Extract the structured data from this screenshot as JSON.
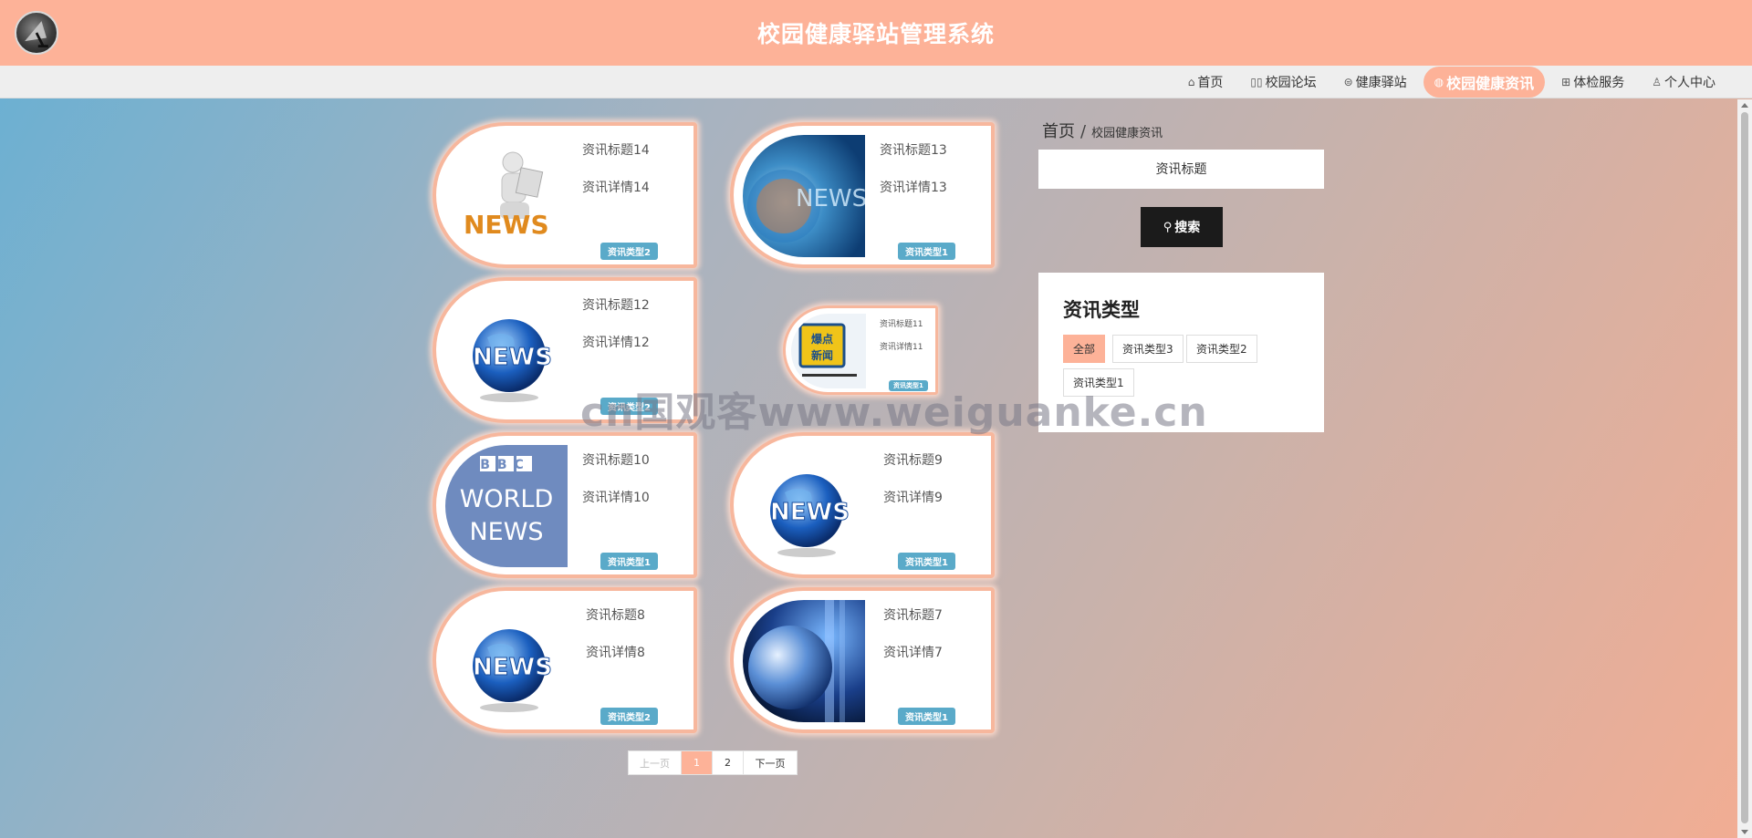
{
  "header": {
    "title": "校园健康驿站管理系统",
    "logo_icon": "satellite-dish-logo"
  },
  "nav": {
    "items": [
      {
        "label": "首页",
        "icon": "home-icon",
        "glyph": "⌂",
        "active": false
      },
      {
        "label": "校园论坛",
        "icon": "forum-icon",
        "glyph": "▯▯",
        "active": false
      },
      {
        "label": "健康驿站",
        "icon": "station-icon",
        "glyph": "⊜",
        "active": false
      },
      {
        "label": "校园健康资讯",
        "icon": "globe-icon",
        "glyph": "◍",
        "active": true
      },
      {
        "label": "体检服务",
        "icon": "gift-icon",
        "glyph": "⊞",
        "active": false
      },
      {
        "label": "个人中心",
        "icon": "user-icon",
        "glyph": "♙",
        "active": false
      }
    ]
  },
  "cards": [
    {
      "title": "资讯标题14",
      "detail": "资讯详情14",
      "type": "资讯类型2",
      "image": "news-3d-man"
    },
    {
      "title": "资讯标题13",
      "detail": "资讯详情13",
      "type": "资讯类型1",
      "image": "news-blue-studio"
    },
    {
      "title": "资讯标题12",
      "detail": "资讯详情12",
      "type": "资讯类型2",
      "image": "news-globe"
    },
    {
      "title": "资讯标题11",
      "detail": "资讯详情11",
      "type": "资讯类型1",
      "image": "hot-news-badge"
    },
    {
      "title": "资讯标题10",
      "detail": "资讯详情10",
      "type": "资讯类型1",
      "image": "bbc-world-news"
    },
    {
      "title": "资讯标题9",
      "detail": "资讯详情9",
      "type": "资讯类型1",
      "image": "news-globe"
    },
    {
      "title": "资讯标题8",
      "detail": "资讯详情8",
      "type": "资讯类型2",
      "image": "news-globe"
    },
    {
      "title": "资讯标题7",
      "detail": "资讯详情7",
      "type": "资讯类型1",
      "image": "news-earth-studio"
    }
  ],
  "images": {
    "bbc_line1": "BBC",
    "bbc_line2": "WORLD",
    "bbc_line3": "NEWS",
    "globe_text": "NEWS",
    "man_text": "NEWS",
    "hot_line1": "爆点",
    "hot_line2": "新闻",
    "studio_text": "NEWS"
  },
  "pagination": {
    "prev": "上一页",
    "pages": [
      "1",
      "2"
    ],
    "current": "1",
    "next": "下一页"
  },
  "breadcrumb": {
    "home": "首页",
    "separator": "/",
    "current": "校园健康资讯"
  },
  "search": {
    "placeholder": "资讯标题",
    "button": "搜索",
    "icon": "search-icon"
  },
  "types": {
    "title": "资讯类型",
    "tags": [
      {
        "label": "全部",
        "active": true
      },
      {
        "label": "资讯类型3",
        "active": false
      },
      {
        "label": "资讯类型2",
        "active": false
      },
      {
        "label": "资讯类型1",
        "active": false
      }
    ]
  },
  "watermark": "cn国观客www.weiguanke.cn",
  "colors": {
    "accent": "#fdb298",
    "type_badge": "#5aaac9",
    "search_button": "#1b1b1b"
  }
}
